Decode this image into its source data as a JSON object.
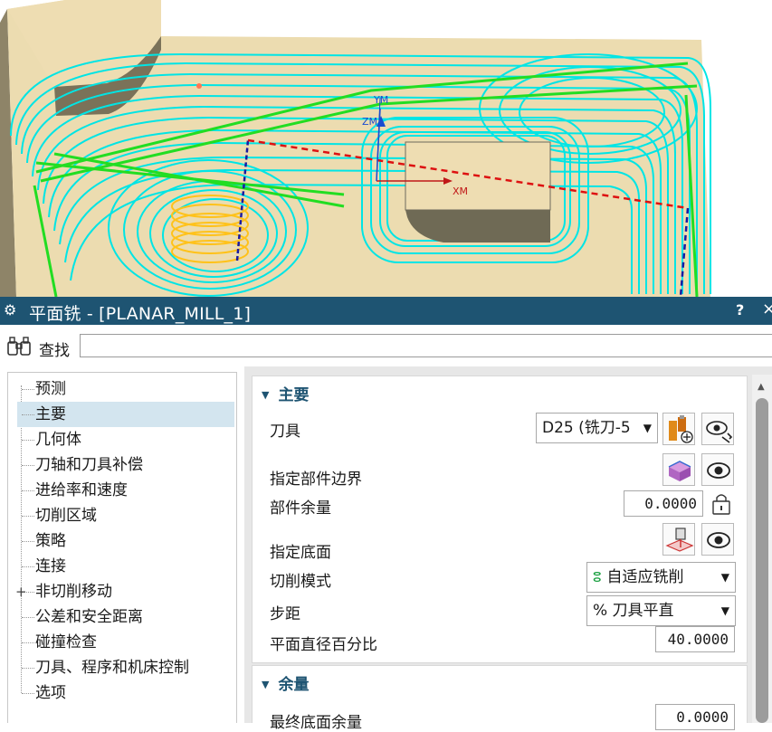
{
  "viewport": {
    "axis_labels": {
      "xm": "XM",
      "ym": "YM",
      "zm": "ZM"
    }
  },
  "titlebar": {
    "icon": "gear-icon",
    "title": "平面铣 - [PLANAR_MILL_1]",
    "help_label": "?",
    "close_label": "×"
  },
  "find": {
    "icon": "binoculars-icon",
    "label": "查找",
    "value": ""
  },
  "nav": {
    "items": [
      {
        "label": "预测"
      },
      {
        "label": "主要"
      },
      {
        "label": "几何体"
      },
      {
        "label": "刀轴和刀具补偿"
      },
      {
        "label": "进给率和速度"
      },
      {
        "label": "切削区域"
      },
      {
        "label": "策略"
      },
      {
        "label": "连接"
      },
      {
        "label": "非切削移动"
      },
      {
        "label": "公差和安全距离"
      },
      {
        "label": "碰撞检查"
      },
      {
        "label": "刀具、程序和机床控制"
      },
      {
        "label": "选项"
      }
    ],
    "selected": "主要",
    "expand_label": "+"
  },
  "main_group": {
    "title": "主要",
    "tool": {
      "label": "刀具",
      "value": "D25 (铣刀-5"
    },
    "part_boundary": {
      "label": "指定部件边界"
    },
    "part_stock": {
      "label": "部件余量",
      "value": "0.0000"
    },
    "floor": {
      "label": "指定底面"
    },
    "cut_pattern": {
      "label": "切削模式",
      "value": "自适应铣削"
    },
    "stepover": {
      "label": "步距",
      "value": "% 刀具平直"
    },
    "percent": {
      "label": "平面直径百分比",
      "value": "40.0000"
    }
  },
  "stock_group": {
    "title": "余量",
    "floor_stock": {
      "label": "最终底面余量",
      "value": "0.0000"
    }
  },
  "colors": {
    "titlebar": "#1e5472",
    "toolpath": "#00e5e5",
    "engage": "#22dd22",
    "helix": "#ffc21a",
    "part": "#ecdcb0",
    "accent": "#1e5472"
  }
}
